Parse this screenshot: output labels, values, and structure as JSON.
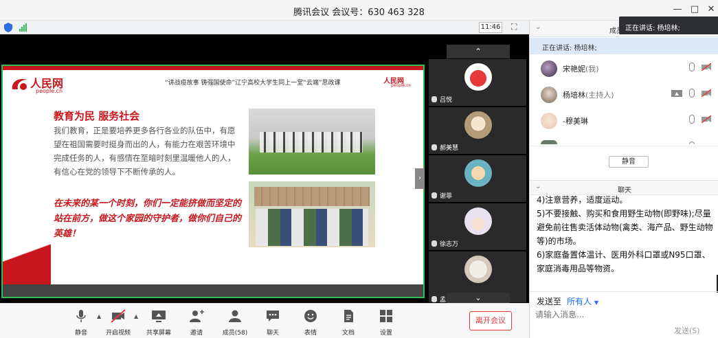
{
  "window": {
    "title": "腾讯会议 会议号：630 463 328"
  },
  "subbar": {
    "time": "11:46"
  },
  "slide": {
    "logo_text": "人民网",
    "logo_sub": "people.cn",
    "banner": "“讲战疫故事 铸强国使命”辽宁高校大学生同上一堂“云端”思政课",
    "banner_logo": "人民网",
    "banner_logo_sub": "people.cn",
    "heading": "教育为民 服务社会",
    "paragraph": "我们教育，正是要培养更多各行各业的队伍中，有愿望在祖国需要时挺身而出的人，有能力在艰苦环境中完成任务的人，有感情在至暗时刻里温暖他人的人，有信心在党的领导下不断传承的人。",
    "calligraphy": "在未来的某一个时刻，你们一定能挤做而坚定的站在前方，做这个家园的守护者，做你们自己的英雄！"
  },
  "thumbnails": [
    {
      "name": "吕悦"
    },
    {
      "name": "郝美慧"
    },
    {
      "name": "谢菲"
    },
    {
      "name": "徐志万"
    },
    {
      "name": "孟..."
    }
  ],
  "toolbar": {
    "mute": "静音",
    "video": "开启视频",
    "share": "共享屏幕",
    "invite": "邀请",
    "members": "成员(58)",
    "chat": "聊天",
    "emoji": "表情",
    "docs": "文档",
    "settings": "设置",
    "leave": "离开会议"
  },
  "right": {
    "members_header": "成员",
    "speaking_tooltip": "正在讲话: 杨培林;",
    "speaking_bar": "正在讲话: 杨培林;",
    "members": [
      {
        "name": "宋艳妮",
        "tag": "(我)"
      },
      {
        "name": "杨培林",
        "tag": "(主持人)"
      },
      {
        "name": "-穆美琳",
        "tag": ""
      }
    ],
    "mute_all": "静音",
    "chat_header": "聊天",
    "chat_lines": [
      "4)注意营养，适度运动。",
      "5)不要接触、购买和食用野生动物(即野味);尽量避免前往售卖活体动物(禽类、海产品、野生动物等)的市场。",
      "6)家庭备置体温计、医用外科口罩或N95口罩、家庭消毒用品等物资。"
    ],
    "send_to_label": "发送至",
    "send_to_value": "所有人",
    "input_placeholder": "请输入消息...",
    "send_button": "发送(S)"
  },
  "colors": {
    "accent_green": "#2fbf55",
    "brand_red": "#c8161d",
    "link_blue": "#1a6dff",
    "leave_red": "#e33b3b"
  }
}
